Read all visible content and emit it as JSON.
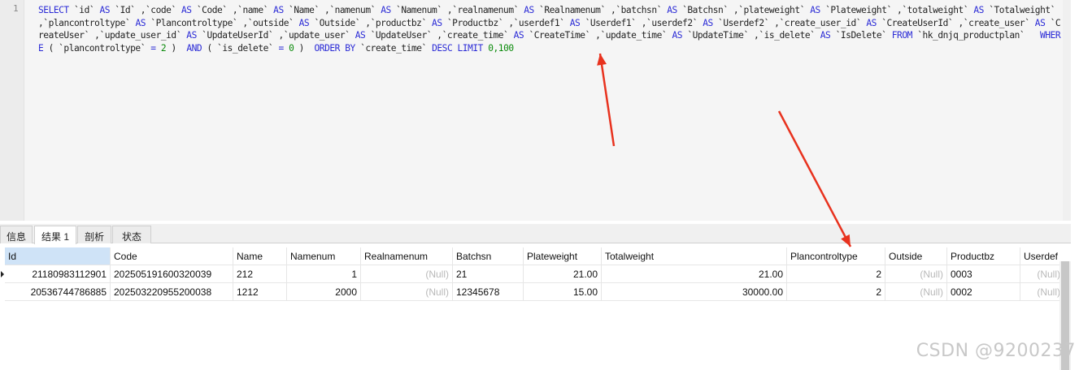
{
  "editor": {
    "line_number": "1",
    "sql_parts": [
      {
        "t": "kw",
        "v": "SELECT "
      },
      {
        "t": "id",
        "v": "`id` "
      },
      {
        "t": "kw",
        "v": "AS "
      },
      {
        "t": "id",
        "v": "`Id` ,"
      },
      {
        "t": "id",
        "v": "`code` "
      },
      {
        "t": "kw",
        "v": "AS "
      },
      {
        "t": "id",
        "v": "`Code` ,"
      },
      {
        "t": "id",
        "v": "`name` "
      },
      {
        "t": "kw",
        "v": "AS "
      },
      {
        "t": "id",
        "v": "`Name` ,"
      },
      {
        "t": "id",
        "v": "`namenum` "
      },
      {
        "t": "kw",
        "v": "AS "
      },
      {
        "t": "id",
        "v": "`Namenum` ,"
      },
      {
        "t": "id",
        "v": "`realnamenum` "
      },
      {
        "t": "kw",
        "v": "AS "
      },
      {
        "t": "id",
        "v": "`Realnamenum` ,"
      },
      {
        "t": "id",
        "v": "`batchsn` "
      },
      {
        "t": "kw",
        "v": "AS "
      },
      {
        "t": "id",
        "v": "`Batchsn` ,"
      },
      {
        "t": "id",
        "v": "`plateweight` "
      },
      {
        "t": "kw",
        "v": "AS "
      },
      {
        "t": "id",
        "v": "`Plateweight` ,"
      },
      {
        "t": "id",
        "v": "`totalweight` "
      },
      {
        "t": "kw",
        "v": "AS "
      },
      {
        "t": "id",
        "v": "`Totalweight` ,"
      },
      {
        "t": "id",
        "v": "`plancontroltype` "
      },
      {
        "t": "kw",
        "v": "AS "
      },
      {
        "t": "id",
        "v": "`Plancontroltype` ,"
      },
      {
        "t": "id",
        "v": "`outside` "
      },
      {
        "t": "kw",
        "v": "AS "
      },
      {
        "t": "id",
        "v": "`Outside` ,"
      },
      {
        "t": "id",
        "v": "`productbz` "
      },
      {
        "t": "kw",
        "v": "AS "
      },
      {
        "t": "id",
        "v": "`Productbz` ,"
      },
      {
        "t": "id",
        "v": "`userdef1` "
      },
      {
        "t": "kw",
        "v": "AS "
      },
      {
        "t": "id",
        "v": "`Userdef1` ,"
      },
      {
        "t": "id",
        "v": "`userdef2` "
      },
      {
        "t": "kw",
        "v": "AS "
      },
      {
        "t": "id",
        "v": "`Userdef2` ,"
      },
      {
        "t": "id",
        "v": "`create_user_id` "
      },
      {
        "t": "kw",
        "v": "AS "
      },
      {
        "t": "id",
        "v": "`CreateUserId` ,"
      },
      {
        "t": "id",
        "v": "`create_user` "
      },
      {
        "t": "kw",
        "v": "AS "
      },
      {
        "t": "id",
        "v": "`CreateUser` ,"
      },
      {
        "t": "id",
        "v": "`update_user_id` "
      },
      {
        "t": "kw",
        "v": "AS "
      },
      {
        "t": "id",
        "v": "`UpdateUserId` ,"
      },
      {
        "t": "id",
        "v": "`update_user` "
      },
      {
        "t": "kw",
        "v": "AS "
      },
      {
        "t": "id",
        "v": "`UpdateUser` ,"
      },
      {
        "t": "id",
        "v": "`create_time` "
      },
      {
        "t": "kw",
        "v": "AS "
      },
      {
        "t": "id",
        "v": "`CreateTime` ,"
      },
      {
        "t": "id",
        "v": "`update_time` "
      },
      {
        "t": "kw",
        "v": "AS "
      },
      {
        "t": "id",
        "v": "`UpdateTime` ,"
      },
      {
        "t": "id",
        "v": "`is_delete` "
      },
      {
        "t": "kw",
        "v": "AS "
      },
      {
        "t": "id",
        "v": "`IsDelete` "
      },
      {
        "t": "kw",
        "v": "FROM "
      },
      {
        "t": "id",
        "v": "`hk_dnjq_productplan`   "
      },
      {
        "t": "kw",
        "v": "WHERE "
      },
      {
        "t": "id",
        "v": "( `plancontroltype` "
      },
      {
        "t": "op",
        "v": "= "
      },
      {
        "t": "num",
        "v": "2"
      },
      {
        "t": "id",
        "v": " )  "
      },
      {
        "t": "kw",
        "v": "AND "
      },
      {
        "t": "id",
        "v": "( `is_delete` "
      },
      {
        "t": "op",
        "v": "= "
      },
      {
        "t": "num",
        "v": "0"
      },
      {
        "t": "id",
        "v": " )  "
      },
      {
        "t": "kw",
        "v": "ORDER BY "
      },
      {
        "t": "id",
        "v": "`create_time` "
      },
      {
        "t": "kw",
        "v": "DESC LIMIT "
      },
      {
        "t": "num",
        "v": "0,100"
      }
    ]
  },
  "tabs": [
    {
      "label": "信息",
      "active": false
    },
    {
      "label": "结果 1",
      "active": true
    },
    {
      "label": "剖析",
      "active": false
    },
    {
      "label": "状态",
      "active": false
    }
  ],
  "grid": {
    "columns": [
      "Id",
      "Code",
      "Name",
      "Namenum",
      "Realnamenum",
      "Batchsn",
      "Plateweight",
      "Totalweight",
      "Plancontroltype",
      "Outside",
      "Productbz",
      "Userdef"
    ],
    "rows": [
      [
        "21180983112901",
        "202505191600320039",
        "212",
        "1",
        "(Null)",
        "21",
        "21.00",
        "21.00",
        "2",
        "(Null)",
        "0003",
        "(Null)"
      ],
      [
        "20536744786885",
        "202503220955200038",
        "1212",
        "2000",
        "(Null)",
        "12345678",
        "15.00",
        "30000.00",
        "2",
        "(Null)",
        "0002",
        "(Null)"
      ]
    ]
  },
  "watermark": "CSDN @9200237",
  "annotation_color": "#e8321e"
}
